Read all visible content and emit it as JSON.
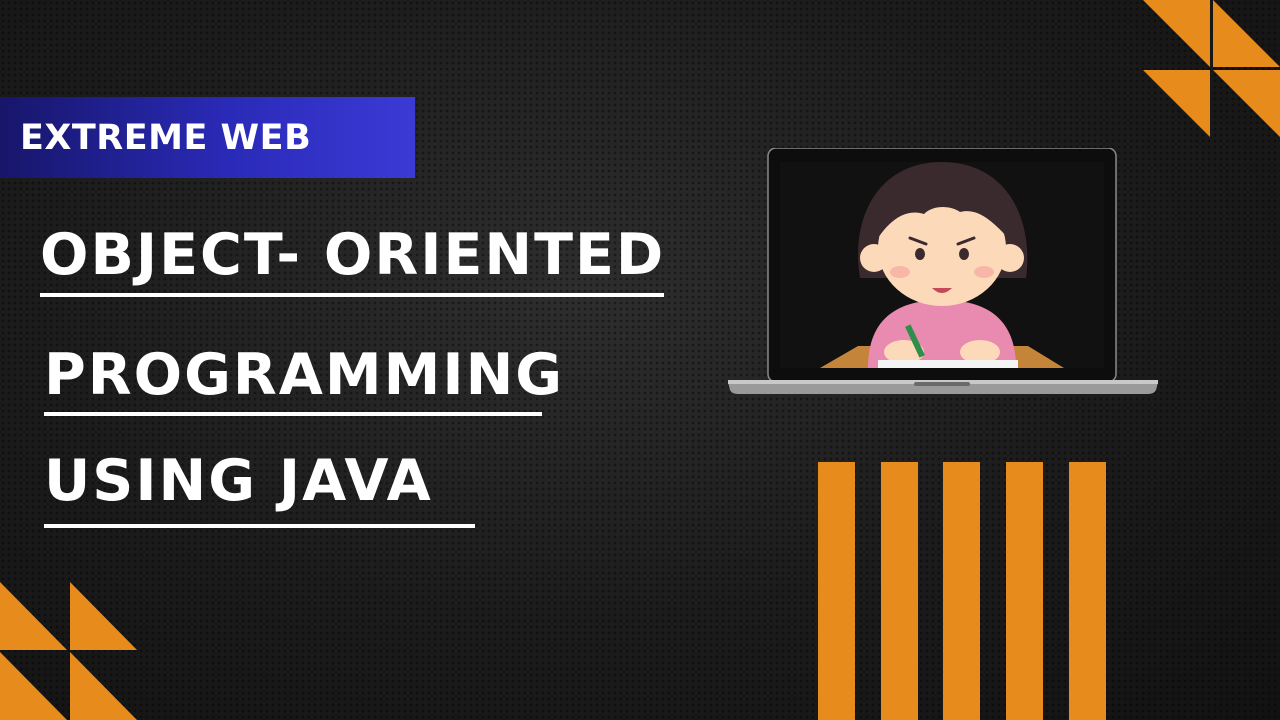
{
  "brand": {
    "label": "EXTREME WEB"
  },
  "title": {
    "line1": "OBJECT- ORIENTED",
    "line2": "PROGRAMMING",
    "line3": "USING  JAVA"
  },
  "illustration": {
    "subject": "girl-studying-illustration",
    "device": "laptop-icon"
  },
  "colors": {
    "accent": "#e78b1d",
    "banner_start": "#17166a",
    "banner_end": "#3b3ad6",
    "text": "#ffffff",
    "background": "#1c1c1c"
  }
}
